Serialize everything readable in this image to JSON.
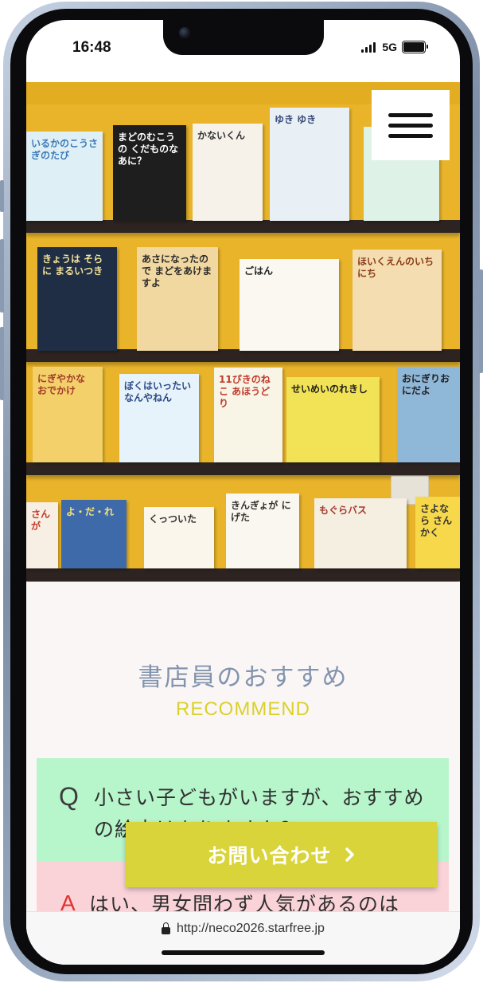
{
  "status_bar": {
    "time": "16:48",
    "network": "5G",
    "signal_bars": 4,
    "battery_level": 1.0
  },
  "hero": {
    "books": [
      {
        "id": "b1",
        "title": "いるかのこうさぎのたび",
        "bg": "#dfeff6",
        "fg": "#3a79b8"
      },
      {
        "id": "b2",
        "title": "まどのむこうの くだものなあに？",
        "bg": "#1e1e1e",
        "fg": "#ffffff"
      },
      {
        "id": "b3",
        "title": "かないくん",
        "bg": "#f6f2ea",
        "fg": "#333333"
      },
      {
        "id": "b4",
        "title": "ゆき ゆき",
        "bg": "#e8f0f6",
        "fg": "#3b4a7a"
      },
      {
        "id": "b5",
        "title": "",
        "bg": "#dff2e8",
        "fg": "#333333"
      },
      {
        "id": "b6",
        "title": "きょうは そらに まるいつき",
        "bg": "#1f2e44",
        "fg": "#f4e39a"
      },
      {
        "id": "b7",
        "title": "あさになったので まどをあけますよ",
        "bg": "#f1d7a0",
        "fg": "#2a2a2a"
      },
      {
        "id": "b8",
        "title": "ごはん",
        "bg": "#fbf8f1",
        "fg": "#222222"
      },
      {
        "id": "b9",
        "title": "ほいくえんのいちにち",
        "bg": "#f4ddb0",
        "fg": "#8a3b1a"
      },
      {
        "id": "b10",
        "title": "にぎやかな おでかけ",
        "bg": "#f3d06a",
        "fg": "#a33b2a"
      },
      {
        "id": "b11",
        "title": "ぼくはいったい なんやねん",
        "bg": "#e7f3fa",
        "fg": "#2b4a88"
      },
      {
        "id": "b12",
        "title": "11ぴきのねこ あほうどり",
        "bg": "#f8f4e6",
        "fg": "#c03a2c"
      },
      {
        "id": "b13",
        "title": "せいめいのれきし",
        "bg": "#f2e255",
        "fg": "#1e1e1e"
      },
      {
        "id": "b14",
        "title": "おにぎりおにだよ",
        "bg": "#8fb7d8",
        "fg": "#222222"
      },
      {
        "id": "b15",
        "title": "さんが",
        "bg": "#f7efe4",
        "fg": "#c23b2c"
      },
      {
        "id": "b16",
        "title": "よ・だ・れ",
        "bg": "#3f6aa9",
        "fg": "#f6e27a"
      },
      {
        "id": "b17",
        "title": "くっついた",
        "bg": "#faf6ec",
        "fg": "#333333"
      },
      {
        "id": "b18",
        "title": "きんぎょが にげた",
        "bg": "#f9f7ef",
        "fg": "#333333"
      },
      {
        "id": "b19",
        "title": "もぐらバス",
        "bg": "#f5efe2",
        "fg": "#a23a2a"
      },
      {
        "id": "b20",
        "title": "さよなら さんかく",
        "bg": "#f7d84b",
        "fg": "#333333"
      }
    ],
    "menu_icon": "hamburger-menu-icon"
  },
  "recommend": {
    "title": "書店員のおすすめ",
    "subtitle": "RECOMMEND",
    "question_mark": "Q",
    "question_text": "小さい子どもがいますが、おすすめの絵本はありますか？",
    "answer_mark": "A",
    "answer_text": "はい、男女問わず人気があるのは"
  },
  "contact": {
    "label": "お問い合わせ",
    "icon": "chevron-right-icon"
  },
  "browser": {
    "url": "http://neco2026.starfree.jp",
    "icon": "lock-icon"
  }
}
